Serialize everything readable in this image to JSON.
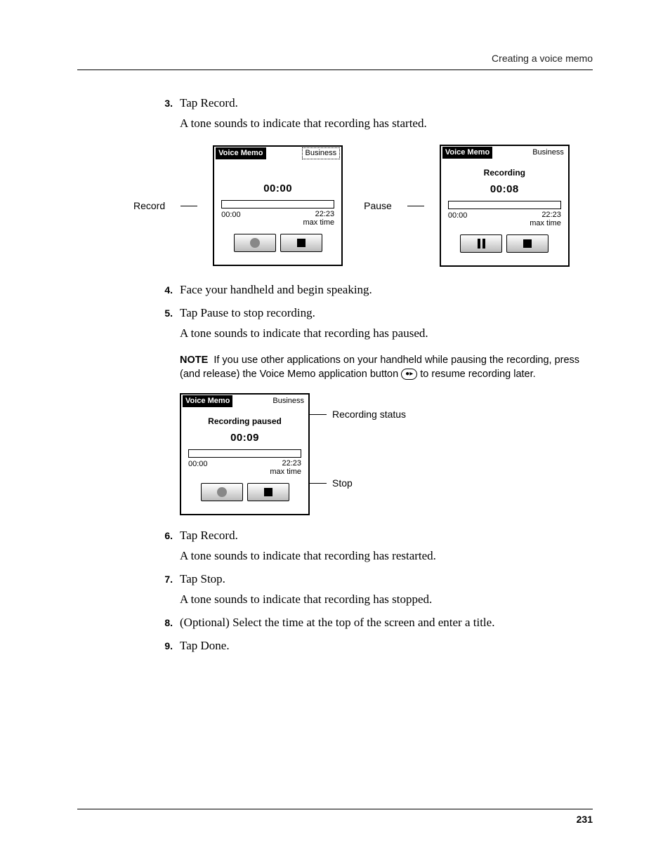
{
  "header": {
    "section_title": "Creating a voice memo"
  },
  "steps": {
    "s3": {
      "num": "3.",
      "text": "Tap Record.",
      "body": "A tone sounds to indicate that recording has started."
    },
    "s4": {
      "num": "4.",
      "text": "Face your handheld and begin speaking."
    },
    "s5": {
      "num": "5.",
      "text": "Tap Pause to stop recording.",
      "body": "A tone sounds to indicate that recording has paused."
    },
    "s6": {
      "num": "6.",
      "text": "Tap Record.",
      "body": "A tone sounds to indicate that recording has restarted."
    },
    "s7": {
      "num": "7.",
      "text": "Tap Stop.",
      "body": "A tone sounds to indicate that recording has stopped."
    },
    "s8": {
      "num": "8.",
      "text": "(Optional) Select the time at the top of the screen and enter a title."
    },
    "s9": {
      "num": "9.",
      "text": "Tap Done."
    }
  },
  "note": {
    "label": "NOTE",
    "text_before": "If you use other applications on your handheld while pausing the recording, press (and release) the Voice Memo application button ",
    "text_after": " to resume recording later."
  },
  "callouts": {
    "record": "Record",
    "pause": "Pause",
    "recording_status": "Recording status",
    "stop": "Stop"
  },
  "device_common": {
    "title": "Voice Memo",
    "category": "Business",
    "bar_start": "00:00",
    "bar_end": "22:23",
    "bar_sub": "max time"
  },
  "device_a": {
    "time": "00:00"
  },
  "device_b": {
    "status": "Recording",
    "time": "00:08"
  },
  "device_c": {
    "status": "Recording paused",
    "time": "00:09"
  },
  "page_number": "231"
}
